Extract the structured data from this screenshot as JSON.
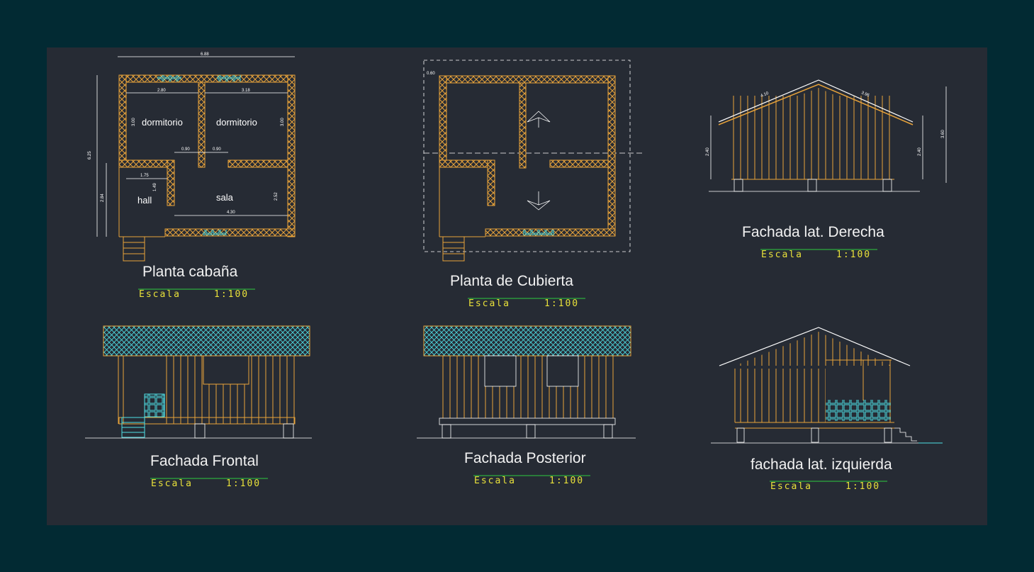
{
  "drawing": {
    "colors": {
      "background": "#022a33",
      "sheet": "#262b34",
      "wall": "#e8a33a",
      "line": "#ffffff",
      "scale_text": "#e8e03a",
      "scale_line": "#2ecc40",
      "window": "#4fe0e6"
    },
    "views": [
      {
        "title": "Planta  cabaña",
        "scale_label": "Escala",
        "scale_value": "1:100"
      },
      {
        "title": "Planta de Cubierta",
        "scale_label": "Escala",
        "scale_value": "1:100"
      },
      {
        "title": "Fachada lat. Derecha",
        "scale_label": "Escala",
        "scale_value": "1:100"
      },
      {
        "title": "Fachada Frontal",
        "scale_label": "Escala",
        "scale_value": "1:100"
      },
      {
        "title": "Fachada Posterior",
        "scale_label": "Escala",
        "scale_value": "1:100"
      },
      {
        "title": "fachada lat. izquierda",
        "scale_label": "Escala",
        "scale_value": "1:100"
      }
    ],
    "rooms": {
      "dormitorio_1": "dormitorio",
      "dormitorio_2": "dormitorio",
      "hall": "hall",
      "sala": "sala"
    },
    "dimensions": {
      "total_width": "6.88",
      "total_height": "6.25",
      "dorm1_width": "2.80",
      "dorm2_width": "3.18",
      "dorm_height_left": "3.00",
      "dorm_height_right": "3.00",
      "door_1": "0.90",
      "door_2": "0.90",
      "hall_width": "1.75",
      "hall_height": "1.49",
      "sala_width": "4.30",
      "sala_height": "2.52",
      "left_lower": "2.84",
      "roof_overhang": "0.60",
      "roof_left": "4.10",
      "roof_right": "3.96",
      "height_left": "2.40",
      "height_right": "2.40",
      "height_total": "3.60"
    }
  }
}
